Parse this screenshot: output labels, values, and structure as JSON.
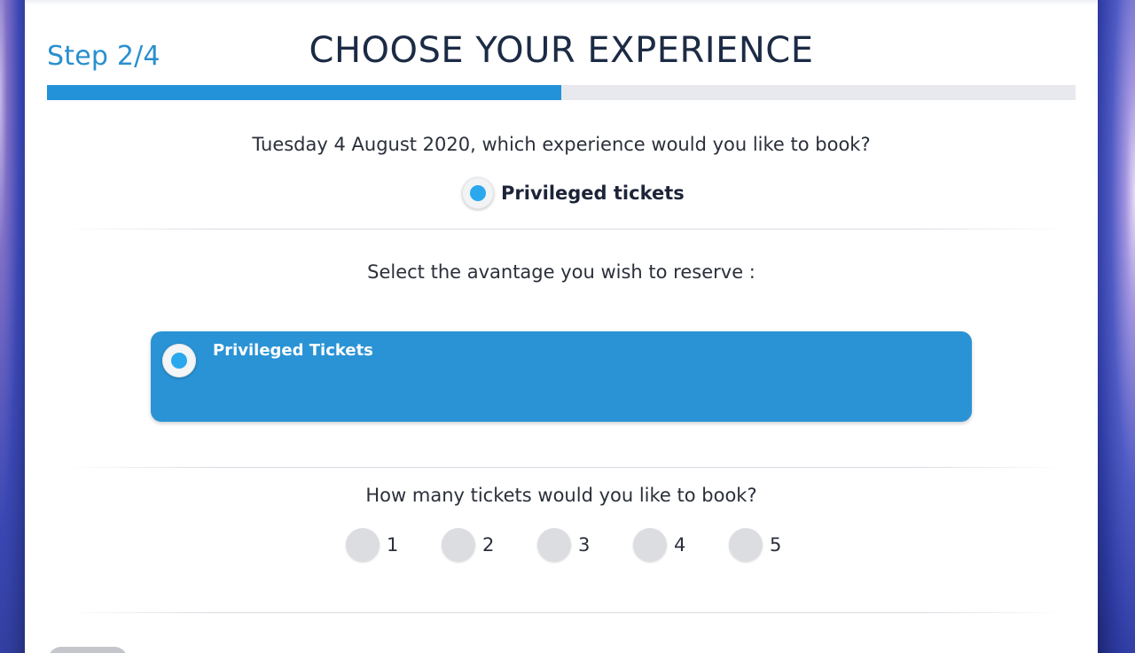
{
  "header": {
    "step": "Step 2/4",
    "title": "CHOOSE YOUR EXPERIENCE",
    "progress": 0.5
  },
  "experience": {
    "question": "Tuesday 4 August 2020, which experience would you like to book?",
    "option_label": "Privileged tickets",
    "selected": true
  },
  "advantage": {
    "question": "Select the avantage you wish to reserve :",
    "card_label": "Privileged Tickets",
    "selected": true
  },
  "tickets": {
    "question": "How many tickets would you like to book?",
    "options": [
      "1",
      "2",
      "3",
      "4",
      "5"
    ]
  },
  "colors": {
    "accent": "#2392d8",
    "title": "#1c2b45",
    "radio_dot": "#2aa8ee"
  }
}
